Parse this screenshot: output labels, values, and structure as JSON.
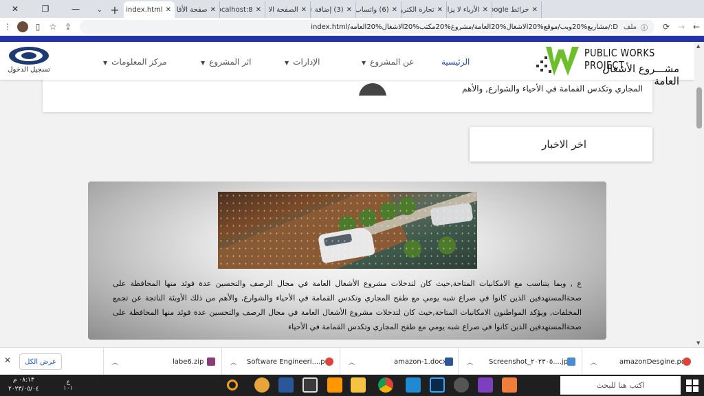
{
  "browser": {
    "tabs": [
      {
        "label": "خرائط Google",
        "icon": "maps-icon",
        "active": false
      },
      {
        "label": "الأرباء لا يزا",
        "icon": "youtube-icon",
        "active": false
      },
      {
        "label": "تجارة الكترو",
        "icon": "youtube-icon",
        "active": false
      },
      {
        "label": "(6) واتساب",
        "icon": "whatsapp-icon",
        "active": false
      },
      {
        "label": "(3) إضافة",
        "icon": "messenger-icon",
        "active": false
      },
      {
        "label": "الصفحة الا",
        "icon": "xampp-icon",
        "active": false
      },
      {
        "label": "localhost:8",
        "icon": "xampp-icon",
        "active": false
      },
      {
        "label": "صفحة الأقا",
        "icon": "xampp-icon",
        "active": false
      },
      {
        "label": "index.html",
        "icon": "globe-icon",
        "active": true
      }
    ],
    "new_tab": "+",
    "address": "D:/مشاريع%20ويب/موقع%20الاشغال%20العامة/مشروع%20مكتب%20الاشغال%20العامه/index.html",
    "file_label": "ملف"
  },
  "site": {
    "logo_en": "PUBLIC WORKS PROJECT",
    "logo_ar": "مشـــروع الأشغال العامة",
    "nav": [
      {
        "label": "الرئيسية",
        "dropdown": false
      },
      {
        "label": "عن المشروع",
        "dropdown": true
      },
      {
        "label": "الإدارات",
        "dropdown": true
      },
      {
        "label": "اثر المشروع",
        "dropdown": true
      },
      {
        "label": "مركز المعلومات",
        "dropdown": true
      }
    ],
    "login_label": "تسجيل الدخول",
    "card_text": "المجاري وتكدس القمامة في الأحياء والشوارع, والأهم",
    "news_title": "اخر الاخبار",
    "news_text": "ع , وبما يتناسب مع الامكانيات المتاحة,حيث كان لتدخلات مشروع الأشغال العامة في مجال الرصف والتحسين عدة فوئد منها المحافظة على صحةالمستهدفين الذين كانوا في صراع شبه يومي مع طفح المجاري وتكدس القمامة في الأحياء والشوارع, والأهم من ذلك الأوبئة الناتجة عن تجمع المخلفات, ويؤكد المواطنون الامكانيات المتاحة,حيث كان لتدخلات مشروع الأشغال العامة في مجال الرصف والتحسين عدة فوئد منها المحافظة على صحةالمستهدفين الذين كانوا في صراع شبه يومي مع طفح المجاري وتكدس القمامة في الأحياء"
  },
  "downloads": {
    "show_all": "عرض الكل",
    "items": [
      {
        "name": "amazonDesgine.pdf",
        "icon": "pdf-icon"
      },
      {
        "name": "Screenshot_٢٠٢٣٠٥....jpg",
        "icon": "image-icon"
      },
      {
        "name": "amazon-1.docx",
        "icon": "word-icon"
      },
      {
        "name": "Software Engineeri....pdf",
        "icon": "pdf-icon"
      },
      {
        "name": "labe6.zip",
        "icon": "zip-icon"
      }
    ]
  },
  "taskbar": {
    "search_placeholder": "اكتب هنا للبحث",
    "time": "٠٨:١٣ م",
    "date": "٢٠٢٣/٠٥/٠٤",
    "lang": "ع",
    "count": "١٠١"
  },
  "colors": {
    "accent_blue": "#2234a8",
    "nav_active": "#2847b0",
    "logo_green": "#6cbf2a"
  }
}
